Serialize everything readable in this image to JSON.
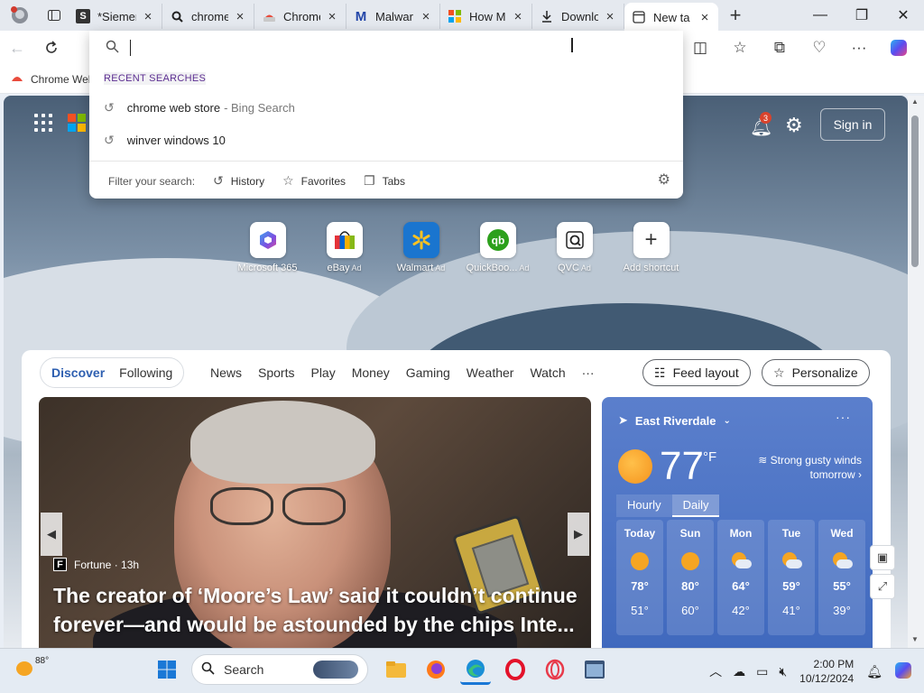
{
  "browser": {
    "tabs": [
      {
        "title": "*Siemen",
        "favicon": "S"
      },
      {
        "title": "chrome",
        "favicon": "search-icon"
      },
      {
        "title": "Chrome",
        "favicon": "chrome-web-store-icon"
      },
      {
        "title": "Malwar",
        "favicon": "malwarebytes-icon"
      },
      {
        "title": "How M",
        "favicon": "microsoft-icon"
      },
      {
        "title": "Downlo",
        "favicon": "download-icon"
      },
      {
        "title": "New ta",
        "favicon": "newtab-icon",
        "active": true
      }
    ],
    "favorites_bar": {
      "item": "Chrome Wel"
    }
  },
  "address_dropdown": {
    "input_value": "",
    "recent_header": "RECENT SEARCHES",
    "recent": [
      {
        "text": "chrome web store",
        "suffix": "- Bing Search"
      },
      {
        "text": "winver windows 10",
        "suffix": ""
      }
    ],
    "filter_label": "Filter your search:",
    "filters": [
      "History",
      "Favorites",
      "Tabs"
    ]
  },
  "newtab": {
    "signin": "Sign in",
    "notifications": "3",
    "shortcuts": [
      {
        "label": "Microsoft 365",
        "ad": ""
      },
      {
        "label": "eBay",
        "ad": "Ad"
      },
      {
        "label": "Walmart",
        "ad": "Ad"
      },
      {
        "label": "QuickBoo...",
        "ad": "Ad"
      },
      {
        "label": "QVC",
        "ad": "Ad"
      },
      {
        "label": "Add shortcut",
        "ad": ""
      }
    ],
    "feed_tabs": [
      "Discover",
      "Following"
    ],
    "categories": [
      "News",
      "Sports",
      "Play",
      "Money",
      "Gaming",
      "Weather",
      "Watch",
      "···"
    ],
    "feed_layout": "Feed layout",
    "personalize": "Personalize",
    "hero": {
      "source": "Fortune · 13h",
      "headline": "The creator of ‘Moore’s Law’ said it couldn’t continue forever—and would be astounded by the chips Inte..."
    },
    "weather": {
      "location": "East Riverdale",
      "temp": "77",
      "unit": "°F",
      "wind": "Strong gusty winds tomorrow",
      "modes": [
        "Hourly",
        "Daily"
      ],
      "days": [
        {
          "name": "Today",
          "hi": "78°",
          "lo": "51°",
          "icon": "sunny"
        },
        {
          "name": "Sun",
          "hi": "80°",
          "lo": "60°",
          "icon": "sunny"
        },
        {
          "name": "Mon",
          "hi": "64°",
          "lo": "42°",
          "icon": "partly-cloudy"
        },
        {
          "name": "Tue",
          "hi": "59°",
          "lo": "41°",
          "icon": "partly-cloudy"
        },
        {
          "name": "Wed",
          "hi": "55°",
          "lo": "39°",
          "icon": "partly-cloudy"
        }
      ]
    }
  },
  "taskbar": {
    "weather_temp": "88°",
    "search_placeholder": "Search",
    "time": "2:00 PM",
    "date": "10/12/2024"
  },
  "colors": {
    "accent": "#2e5fb0",
    "weather_bg": "#4a72c4",
    "badge": "#d9432c"
  }
}
